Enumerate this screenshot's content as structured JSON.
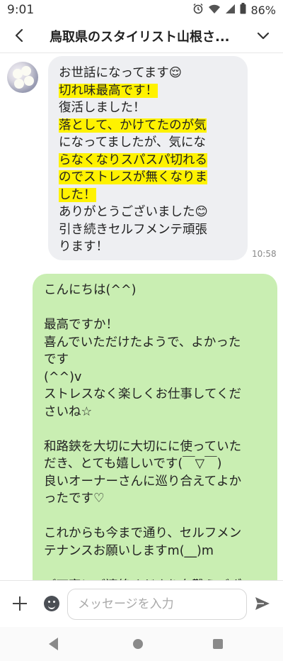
{
  "status": {
    "time": "9:01",
    "battery": "86%",
    "icons": [
      "alarm-icon",
      "wifi-icon",
      "signal-icon",
      "battery-icon"
    ]
  },
  "header": {
    "title": "鳥取県のスタイリスト山根さ...",
    "back_icon": "back-arrow-icon",
    "menu_icon": "chevron-down-icon"
  },
  "incoming": {
    "timestamp": "10:58",
    "lines": [
      "お世話になってます😌",
      "切れ味最高です！",
      "復活しました！",
      "落として、かけてたのが気",
      "になってましたが、気にな",
      "らなくなりスパスパ切れる",
      "のでストレスが無くなりま",
      "した！",
      "ありがとうございました😊",
      "引き続きセルフメンテ頑張",
      "ります！"
    ]
  },
  "outgoing": {
    "text": "こんにちは(^^)\n\n最高ですか！\n喜んでいただけたようで、よかった\nです\n(^^)v\nストレスなく楽しくお仕事してくだ\nさいね☆\n\n和路鋏を大切に大切にに使っていた\nだき、とても嬉しいです(￣▽￣)\n良いオーナーさんに巡り合えてよか\nったです♡\n\nこれからも今まで通り、セルフメン\nテナンスお願いしますm(__)m\n\nご丁寧にご連絡くださり有難うござ"
  },
  "composer": {
    "placeholder": "メッセージを入力",
    "plus_icon": "plus-icon",
    "emoji_icon": "emoji-icon",
    "send_icon": "send-icon"
  },
  "colors": {
    "incoming_bubble": "#eeeff2",
    "outgoing_bubble": "#c9eeb2",
    "highlight": "#fff200"
  }
}
